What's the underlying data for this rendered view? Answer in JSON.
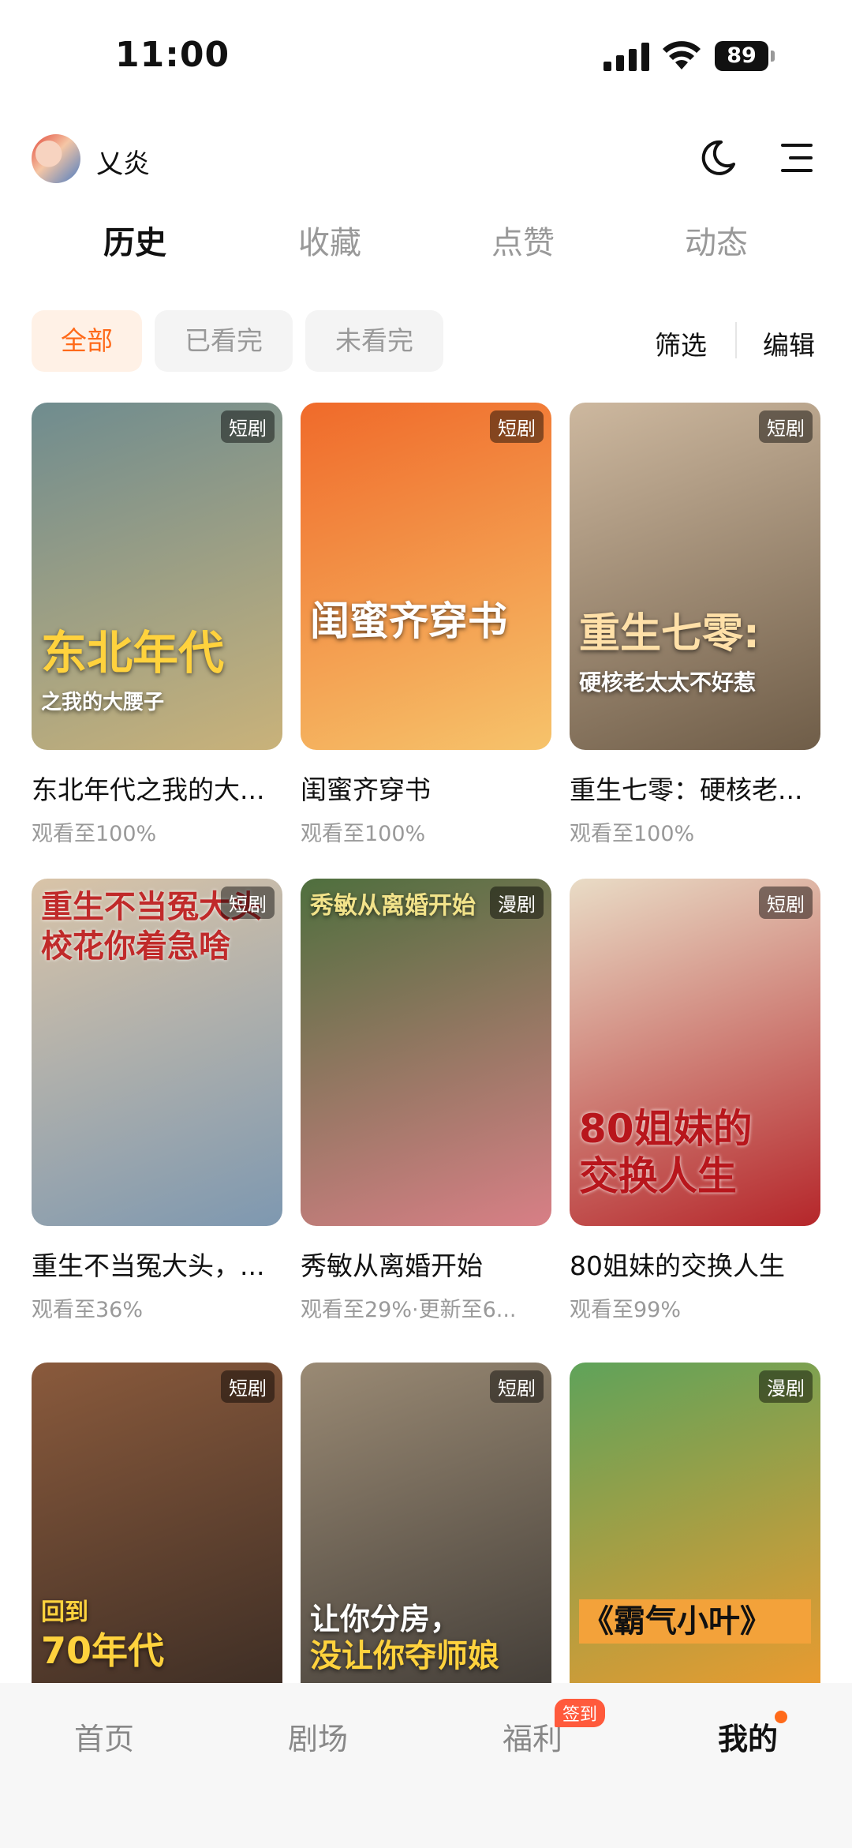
{
  "status_bar": {
    "time": "11:00",
    "battery": "89"
  },
  "header": {
    "username": "乂炎"
  },
  "tabs": [
    {
      "label": "历史",
      "active": true
    },
    {
      "label": "收藏",
      "active": false
    },
    {
      "label": "点赞",
      "active": false
    },
    {
      "label": "动态",
      "active": false
    }
  ],
  "filters": {
    "chips": [
      {
        "label": "全部",
        "active": true
      },
      {
        "label": "已看完",
        "active": false
      },
      {
        "label": "未看完",
        "active": false
      }
    ],
    "filter_label": "筛选",
    "edit_label": "编辑"
  },
  "items": [
    {
      "title": "东北年代之我的大...",
      "progress": "观看至100%",
      "badge": "短剧",
      "poster_title": "东北年代",
      "poster_sub": "之我的大腰子",
      "colors": [
        "#6f8c8f",
        "#c9b27a"
      ]
    },
    {
      "title": "闺蜜齐穿书",
      "progress": "观看至100%",
      "badge": "短剧",
      "poster_title": "闺蜜齐穿书",
      "poster_sub": "",
      "colors": [
        "#f06a2a",
        "#f6c36b"
      ]
    },
    {
      "title": "重生七零：硬核老...",
      "progress": "观看至100%",
      "badge": "短剧",
      "poster_title": "重生七零:",
      "poster_sub": "硬核老太太不好惹",
      "colors": [
        "#cdb89f",
        "#6f5d48"
      ]
    },
    {
      "title": "重生不当冤大头，...",
      "progress": "观看至36%",
      "badge": "短剧",
      "poster_title": "重生不当冤大头",
      "poster_sub": "校花你着急啥",
      "colors": [
        "#d9c4a8",
        "#7e98b0"
      ]
    },
    {
      "title": "秀敏从离婚开始",
      "progress": "观看至29%·更新至6...",
      "badge": "漫剧",
      "poster_title": "秀敏从离婚开始",
      "poster_sub": "",
      "colors": [
        "#4f6f3e",
        "#d87f86"
      ]
    },
    {
      "title": "80姐妹的交换人生",
      "progress": "观看至99%",
      "badge": "短剧",
      "poster_title": "80姐妹的",
      "poster_sub": "交换人生",
      "colors": [
        "#e9dcc6",
        "#b5262a"
      ]
    },
    {
      "title": "",
      "progress": "",
      "badge": "短剧",
      "poster_title": "回到",
      "poster_sub": "70年代",
      "colors": [
        "#8a5a3c",
        "#3a2c24"
      ]
    },
    {
      "title": "",
      "progress": "",
      "badge": "短剧",
      "poster_title": "让你分房，",
      "poster_sub": "没让你夺师娘",
      "colors": [
        "#9a8a74",
        "#3f3a35"
      ]
    },
    {
      "title": "",
      "progress": "",
      "badge": "漫剧",
      "poster_title": "《霸气小叶》",
      "poster_sub": "",
      "colors": [
        "#5fa35a",
        "#f19a2d"
      ]
    }
  ],
  "bottom_nav": [
    {
      "label": "首页",
      "active": false
    },
    {
      "label": "剧场",
      "active": false
    },
    {
      "label": "福利",
      "active": false,
      "badge": "签到"
    },
    {
      "label": "我的",
      "active": true
    }
  ]
}
